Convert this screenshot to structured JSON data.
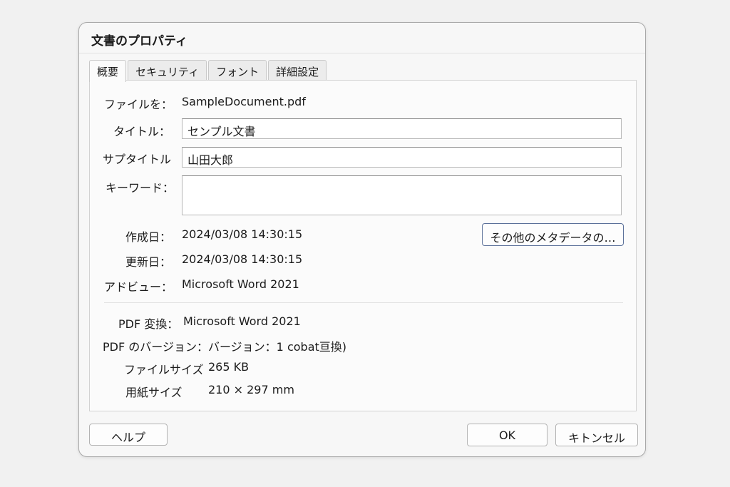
{
  "dialog": {
    "title": "文書のプロパティ"
  },
  "tabs": [
    {
      "label": "概要"
    },
    {
      "label": "セキュリティ"
    },
    {
      "label": "フォント"
    },
    {
      "label": "詳細設定"
    }
  ],
  "summary": {
    "filename_label": "ファイルを：",
    "filename_value": "SampleDocument.pdf",
    "title_label": "タイトル：",
    "title_value": "センプル文書",
    "subtitle_label": "サプタイトル",
    "subtitle_value": "山田大郎",
    "keywords_label": "キーワード：",
    "keywords_value": "",
    "created_label": "作成日：",
    "created_value": "2024/03/08 14:30:15",
    "modified_label": "更新日：",
    "modified_value": "2024/03/08 14:30:15",
    "application_label": "アドビュー：",
    "application_value": "Microsoft Word 2021",
    "more_metadata_button": "その他のメタデータの…",
    "pdf_producer_label": "PDF 変換：",
    "pdf_producer_value": "Microsoft Word 2021",
    "pdf_version_label": "PDF のバージョン：",
    "pdf_version_value": "バージョン：1 cobat亘換)",
    "file_size_label": "ファイルサイズ",
    "file_size_value": "265 KB",
    "page_size_label": "用紙サイズ",
    "page_size_value": "210 × 297 mm"
  },
  "footer": {
    "help_button": "ヘルプ",
    "ok_button": "OK",
    "cancel_button": "キトンセル"
  },
  "colors": {
    "background": "#f1f1f1",
    "dialog": "#f7f7f7",
    "accent_border": "#5a6f98"
  }
}
